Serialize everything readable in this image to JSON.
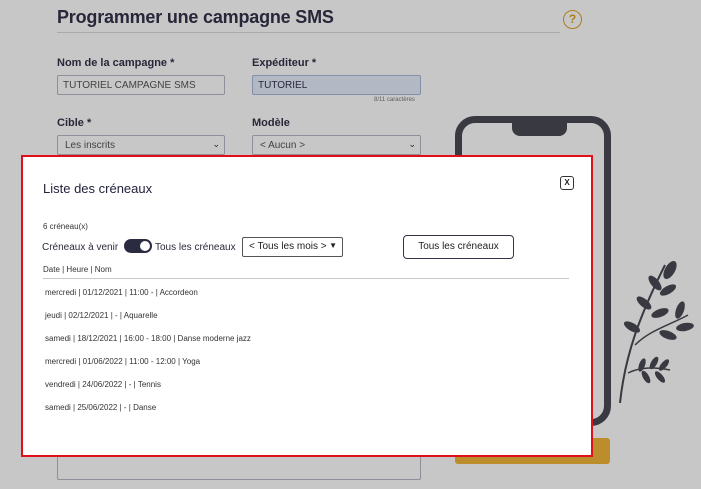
{
  "page": {
    "title": "Programmer une campagne SMS",
    "help_icon": "?",
    "fields": {
      "campaign_name_label": "Nom de la campagne *",
      "campaign_name_value": "TUTORIEL CAMPAGNE SMS",
      "sender_label": "Expéditeur *",
      "sender_value": "TUTORIEL",
      "sender_count": "8/11 caractères",
      "target_label": "Cible *",
      "target_value": "Les inscrits",
      "template_label": "Modèle",
      "template_value": "< Aucun >"
    },
    "accent_color": "#f0b53a"
  },
  "modal": {
    "title": "Liste des créneaux",
    "close_label": "X",
    "count_text": "6 créneau(x)",
    "filter_upcoming_label": "Créneaux à venir",
    "filter_all_label": "Tous les créneaux",
    "toggle_on": true,
    "month_select_value": "< Tous les mois >",
    "all_button_label": "Tous les créneaux",
    "column_header": "Date | Heure | Nom",
    "rows": [
      "mercredi | 01/12/2021 | 11:00 - | Accordeon",
      "jeudi | 02/12/2021 | - | Aquarelle",
      "samedi | 18/12/2021 | 16:00 - 18:00 | Danse moderne jazz",
      "mercredi | 01/06/2022 | 11:00 - 12:00 | Yoga",
      "vendredi | 24/06/2022 | - | Tennis",
      "samedi | 25/06/2022 | - | Danse"
    ],
    "border_color": "#e00f1a"
  }
}
